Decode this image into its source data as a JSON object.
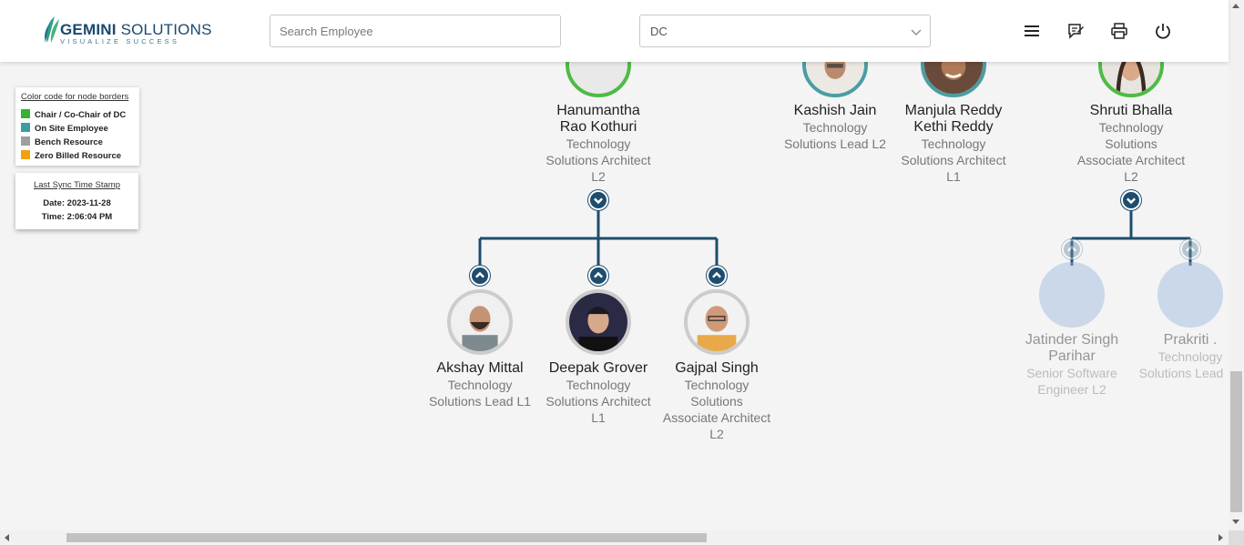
{
  "header": {
    "logo_main_bold": "GEMINI",
    "logo_main_light": " SOLUTIONS",
    "logo_tagline": "VISUALIZE SUCCESS",
    "search_placeholder": "Search Employee",
    "dropdown_value": "DC",
    "icons": [
      "menu-icon",
      "feedback-icon",
      "print-icon",
      "power-icon"
    ]
  },
  "legend": {
    "title": "Color code for node borders",
    "items": [
      {
        "label": "Chair / Co-Chair of DC",
        "color": "#33b233"
      },
      {
        "label": "On Site Employee",
        "color": "#3a9e9e"
      },
      {
        "label": "Bench Resource",
        "color": "#9e9e9e"
      },
      {
        "label": "Zero Billed Resource",
        "color": "#f2a20f"
      }
    ]
  },
  "sync": {
    "title": "Last Sync Time Stamp",
    "date": "Date: 2023-11-28",
    "time": "Time: 2:06:04 PM"
  },
  "colors": {
    "chair": "#4dbb45",
    "onsite": "#4a9ea3",
    "bench": "#a8a8a8",
    "connector": "#1e4d6e",
    "faded_avatar": "#c5d7ee"
  },
  "nodes": {
    "hanumantha": {
      "name_1": "Hanumantha",
      "name_2": "Rao Kothuri",
      "role_1": "Technology",
      "role_2": "Solutions Architect",
      "role_3": "L2"
    },
    "kashish": {
      "name_1": "Kashish Jain",
      "role_1": "Technology",
      "role_2": "Solutions Lead L2"
    },
    "manjula": {
      "name_1": "Manjula Reddy",
      "name_2": "Kethi Reddy",
      "role_1": "Technology",
      "role_2": "Solutions Architect",
      "role_3": "L1"
    },
    "shruti": {
      "name_1": "Shruti Bhalla",
      "role_1": "Technology",
      "role_2": "Solutions",
      "role_3": "Associate Architect",
      "role_4": "L2"
    },
    "akshay": {
      "name_1": "Akshay Mittal",
      "role_1": "Technology",
      "role_2": "Solutions Lead L1"
    },
    "deepak": {
      "name_1": "Deepak Grover",
      "role_1": "Technology",
      "role_2": "Solutions Architect",
      "role_3": "L1"
    },
    "gajpal": {
      "name_1": "Gajpal Singh",
      "role_1": "Technology",
      "role_2": "Solutions",
      "role_3": "Associate Architect",
      "role_4": "L2"
    },
    "jatinder": {
      "name_1": "Jatinder Singh",
      "name_2": "Parihar",
      "role_1": "Senior Software",
      "role_2": "Engineer L2"
    },
    "prakriti": {
      "name_1": "Prakriti .",
      "role_1": "Technology",
      "role_2": "Solutions Lead"
    }
  }
}
